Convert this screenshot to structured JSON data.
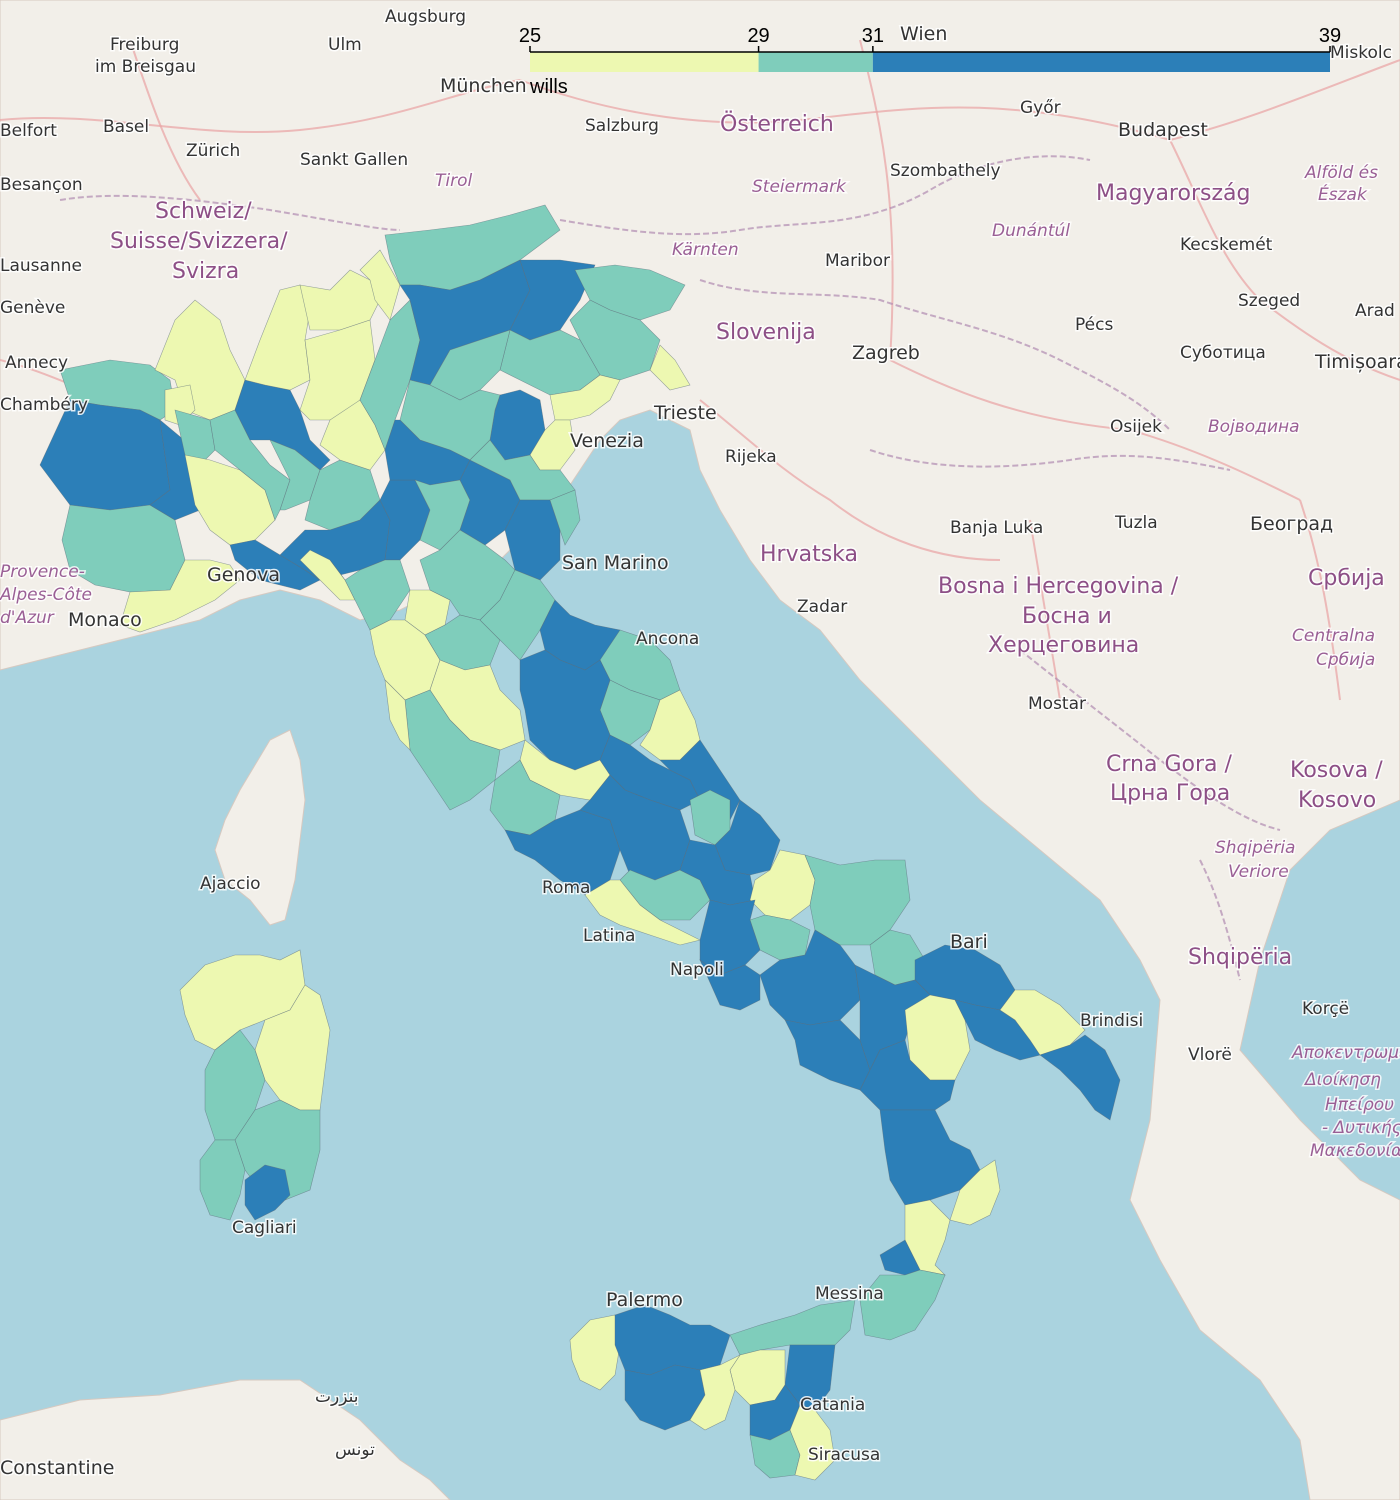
{
  "legend": {
    "caption": "wills",
    "ticks": [
      "25",
      "29",
      "31",
      "39"
    ],
    "breaks": [
      25,
      29,
      31,
      39
    ],
    "colors": [
      "#edf8b1",
      "#7fcdbb",
      "#2c7fb8"
    ]
  },
  "colors": {
    "sea": "#aad3df",
    "land": "#f2efe9",
    "low": "#edf8b1",
    "mid": "#7fcdbb",
    "high": "#2c7fb8"
  },
  "basemap": {
    "countries": [
      "Schweiz/",
      "Suisse/Svizzera/",
      "Svizra",
      "Österreich",
      "Magyarország",
      "Slovenija",
      "Hrvatska",
      "Bosna i Hercegovina /",
      "Босна и",
      "Херцеговина",
      "Crna Gora /",
      "Црна Гора",
      "Србија",
      "Kosova /",
      "Kosovo",
      "Shqipëria"
    ],
    "cities": [
      "Augsburg",
      "Ulm",
      "Freiburg",
      "im Breisgau",
      "München",
      "Wien",
      "Miskolc",
      "Belfort",
      "Basel",
      "Zürich",
      "Sankt Gallen",
      "Salzburg",
      "Győr",
      "Budapest",
      "Besançon",
      "Szombathely",
      "Lausanne",
      "Kecskemét",
      "Maribor",
      "Szeged",
      "Arad",
      "Genève",
      "Annecy",
      "Pécs",
      "Zagreb",
      "Суботица",
      "Timișoara",
      "Chambéry",
      "Trieste",
      "Osijek",
      "Rijeka",
      "Banja Luka",
      "Tuzla",
      "Београд",
      "Genova",
      "Monaco",
      "Zadar",
      "Ancona",
      "Mostar",
      "Ajaccio",
      "Roma",
      "Latina",
      "Bari",
      "Brindisi",
      "Korçë",
      "Vlorë",
      "Cagliari",
      "Palermo",
      "Messina",
      "Catania",
      "Siracusa",
      "Constantine",
      "بنزرت",
      "تونس",
      "Napoli",
      "San Marino",
      "Venezia"
    ],
    "regions": [
      "Tirol",
      "Steiermark",
      "Kärnten",
      "Dunántúl",
      "Alföld és",
      "Észak",
      "Војводина",
      "Centralna",
      "Србија",
      "Shqipëria",
      "Veriore",
      "Provence-",
      "Alpes-Côte",
      "d'Azur",
      "Αποκεντρωμένη",
      "Διοίκηση",
      "Ηπείρου",
      "- Δυτικής",
      "Μακεδονίας"
    ]
  }
}
